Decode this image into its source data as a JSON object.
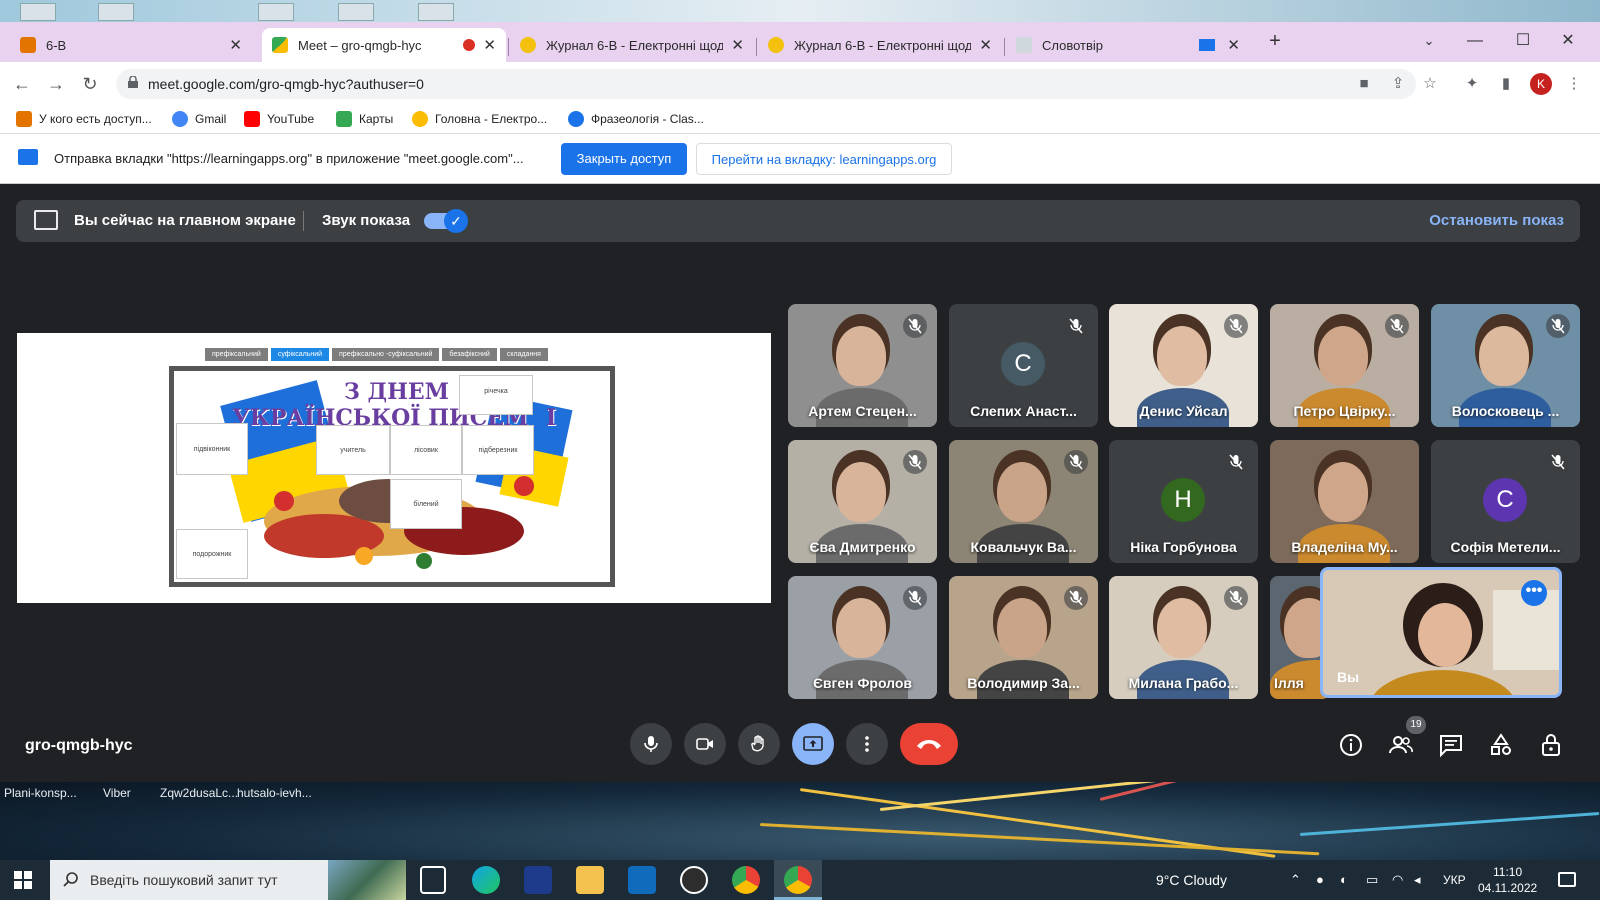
{
  "browser": {
    "tabs": [
      {
        "title": "6-В",
        "active": false
      },
      {
        "title": "Meet – gro-qmgb-hyc",
        "active": true,
        "recording": true
      },
      {
        "title": "Журнал 6-В - Електронні щоден",
        "active": false
      },
      {
        "title": "Журнал 6-В - Електронні щоден",
        "active": false
      },
      {
        "title": "Словотвір",
        "active": false
      }
    ],
    "new_tab_label": "+",
    "url": "meet.google.com/gro-qmgb-hyc?authuser=0",
    "profile_initial": "K",
    "bookmarks": [
      {
        "label": "У кого есть доступ...",
        "color": "#e37400"
      },
      {
        "label": "Gmail",
        "color": "#4285f4"
      },
      {
        "label": "YouTube",
        "color": "#ff0000"
      },
      {
        "label": "Карты",
        "color": "#34a853"
      },
      {
        "label": "Головна - Електро...",
        "color": "#fbbc04"
      },
      {
        "label": "Фразеологія - Clas...",
        "color": "#1a73e8"
      }
    ]
  },
  "infobar": {
    "message": "Отправка вкладки \"https://learningapps.org\" в приложение \"meet.google.com\"...",
    "close_access_label": "Закрыть доступ",
    "goto_tab_label": "Перейти на вкладку: learningapps.org"
  },
  "meet": {
    "banner_text": "Вы сейчас на главном экране",
    "sound_label": "Звук показа",
    "stop_label": "Остановить показ",
    "meeting_code": "gro-qmgb-hyc",
    "people_count": "19",
    "shared_screen": {
      "tabs": [
        "префіксальний",
        "суфіксальний",
        "префіксально -суфіксальний",
        "безафіксний",
        "складання"
      ],
      "selected_tab": "суфіксальний",
      "title_line1": "З ДНЕМ",
      "title_line2": "УКРАЇНСЬКОЇ ПИСЕМ",
      "title_line2_end": "І",
      "pieces": [
        "річечка",
        "підвіконник",
        "учитель",
        "лісовик",
        "підберезник",
        "білений",
        "подорожник"
      ]
    },
    "participants": [
      {
        "name": "Артем Стецен...",
        "muted": true,
        "type": "video"
      },
      {
        "name": "Слепих Анаст...",
        "muted": true,
        "type": "avatar",
        "initial": "С",
        "color": "#455a64"
      },
      {
        "name": "Денис Уйсал",
        "muted": true,
        "type": "video"
      },
      {
        "name": "Петро Цвірку...",
        "muted": true,
        "type": "video"
      },
      {
        "name": "Волосковець ...",
        "muted": true,
        "type": "video"
      },
      {
        "name": "Єва Дмитренко",
        "muted": true,
        "type": "video"
      },
      {
        "name": "Ковальчук Ва...",
        "muted": true,
        "type": "video"
      },
      {
        "name": "Ніка Горбунова",
        "muted": true,
        "type": "avatar",
        "initial": "Н",
        "color": "#33691e"
      },
      {
        "name": "Владеліна Му...",
        "muted": false,
        "type": "video"
      },
      {
        "name": "Софія Метели...",
        "muted": true,
        "type": "avatar",
        "initial": "С",
        "color": "#5e35b1"
      },
      {
        "name": "Євген Фролов",
        "muted": true,
        "type": "video"
      },
      {
        "name": "Володимир За...",
        "muted": true,
        "type": "video"
      },
      {
        "name": "Милана Грабо...",
        "muted": true,
        "type": "video"
      },
      {
        "name": "Ілля",
        "muted": false,
        "type": "video"
      }
    ],
    "self_name": "Вы"
  },
  "desktop": {
    "icons": [
      "Plani-konsp...",
      "Viber",
      "Zqw2dusaLc...",
      "hutsalo-ievh..."
    ]
  },
  "taskbar": {
    "search_placeholder": "Введіть пошуковий запит тут",
    "weather": "9°C  Cloudy",
    "language": "УКР",
    "time": "11:10",
    "date": "04.11.2022"
  },
  "colors": {
    "meet_bg": "#202124",
    "accent_blue": "#1a73e8",
    "leave_red": "#ea4335",
    "tabbar": "#e8d2f0"
  }
}
